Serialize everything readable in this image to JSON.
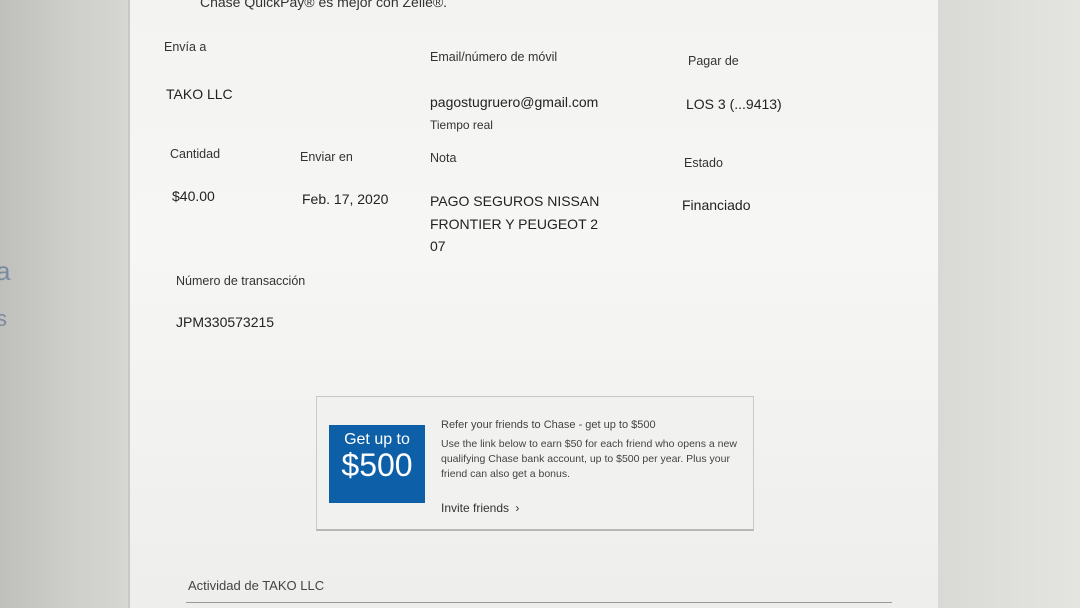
{
  "header": {
    "quickpay_note": "Chase QuickPay® es mejor con Zelle®."
  },
  "details": {
    "send_to_label": "Envía a",
    "send_to_value": "TAKO LLC",
    "email_label": "Email/número de móvil",
    "email_value": "pagostugruero@gmail.com",
    "email_sub": "Tiempo real",
    "pay_from_label": "Pagar de",
    "pay_from_value": "LOS 3 (...9413)",
    "amount_label": "Cantidad",
    "amount_value": "$40.00",
    "send_on_label": "Enviar en",
    "send_on_value": "Feb. 17, 2020",
    "note_label": "Nota",
    "note_line1": "PAGO SEGUROS NISSAN",
    "note_line2": "FRONTIER Y PEUGEOT 2",
    "note_line3": "07",
    "status_label": "Estado",
    "status_value": "Financiado",
    "transaction_label": "Número de transacción",
    "transaction_value": "JPM330573215"
  },
  "promo": {
    "image_line1": "Get up to",
    "image_line2": "$500",
    "title": "Refer your friends to Chase - get up to $500",
    "body": "Use the link below to earn $50 for each friend who opens a new qualifying Chase bank account, up to $500 per year. Plus your friend can also get a bonus.",
    "link": "Invite friends",
    "link_icon": "chevron-right-icon",
    "image_color": "#0d5fa8"
  },
  "activity": {
    "label": "Actividad de TAKO LLC"
  },
  "edge_chars": [
    "a",
    "s"
  ]
}
